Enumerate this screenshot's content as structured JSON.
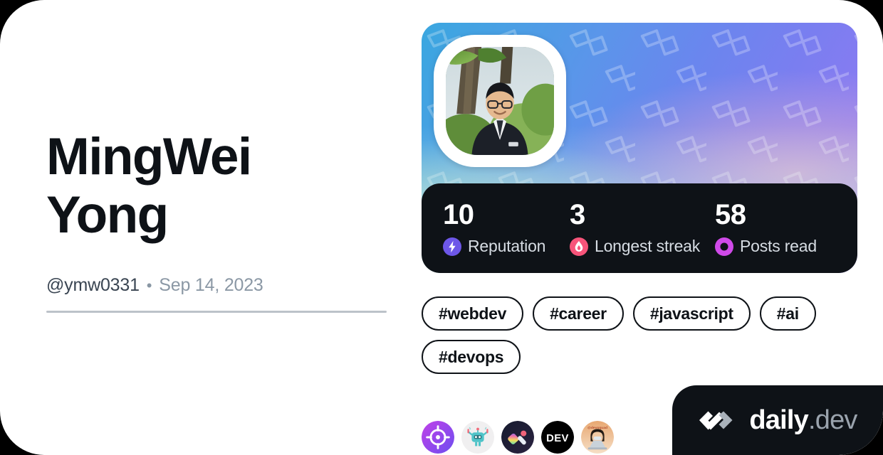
{
  "profile": {
    "display_name": "MingWei Yong",
    "handle": "@ymw0331",
    "separator": "•",
    "joined_date": "Sep 14, 2023",
    "avatar_alt": "profile-photo"
  },
  "stats": [
    {
      "value": "10",
      "label": "Reputation",
      "icon": "lightning-bolt-icon",
      "color": "#6d57e8"
    },
    {
      "value": "3",
      "label": "Longest streak",
      "icon": "flame-icon",
      "color": "#f7547a"
    },
    {
      "value": "58",
      "label": "Posts read",
      "icon": "ring-icon",
      "color": "#cf4ae8"
    }
  ],
  "tags": [
    {
      "label": "#webdev"
    },
    {
      "label": "#career"
    },
    {
      "label": "#javascript"
    },
    {
      "label": "#ai"
    },
    {
      "label": "#devops"
    }
  ],
  "sources": [
    {
      "name": "source-avatar-crosshair"
    },
    {
      "name": "source-avatar-robot"
    },
    {
      "name": "source-avatar-gradient-logo"
    },
    {
      "name": "source-avatar-dev-to",
      "label": "DEV"
    },
    {
      "name": "source-avatar-person"
    }
  ],
  "brand": {
    "name_primary": "daily",
    "name_secondary": ".dev",
    "mark": "daily-dev-logo-icon"
  },
  "colors": {
    "background": "#000000",
    "card": "#ffffff",
    "ink": "#0e1217",
    "muted": "#8b98a5",
    "handle": "#3a4552",
    "divider": "#bcc2c9",
    "stats_bar": "#0e1217",
    "stat_label": "#d6dce3",
    "brand_secondary": "#9aa3ad"
  }
}
